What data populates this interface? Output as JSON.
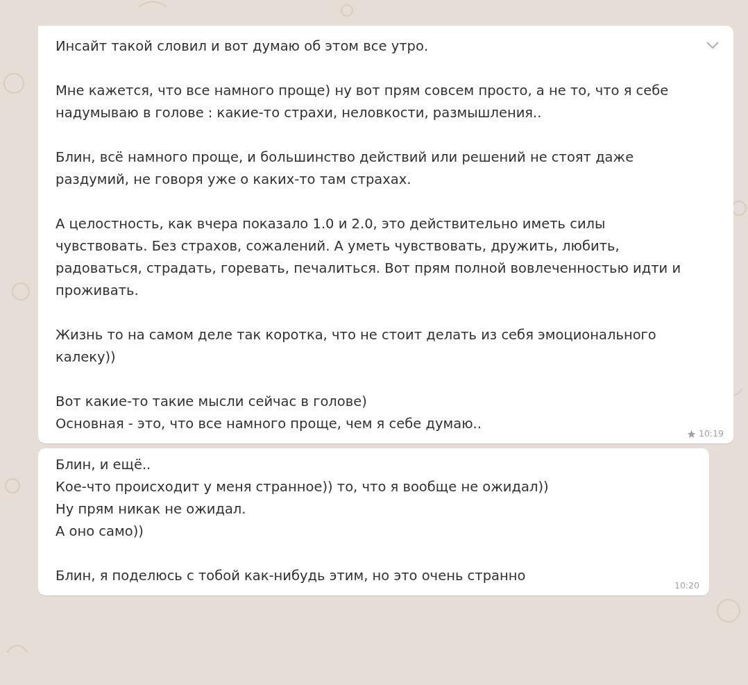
{
  "messages": [
    {
      "paragraphs": [
        [
          "Инсайт такой словил и вот думаю об этом все утро."
        ],
        [
          "Мне кажется, что все намного проще) ну вот прям совсем просто, а не то, что я себе надумываю в голове : какие-то страхи, неловкости, размышления.."
        ],
        [
          "Блин, всё намного проще, и большинство действий или решений не стоят даже раздумий, не говоря уже о каких-то там страхах."
        ],
        [
          "А целостность, как вчера показало 1.0 и 2.0, это действительно иметь силы чувствовать. Без страхов, сожалений. А уметь чувствовать, дружить, любить, радоваться, страдать, горевать, печалиться. Вот прям полной вовлеченностью идти и проживать."
        ],
        [
          "Жизнь то на самом деле так коротка, что не стоит делать из себя эмоционального калеку))"
        ],
        [
          "Вот какие-то такие мысли сейчас в голове)",
          "Основная - это, что все намного проще, чем я себе думаю.."
        ]
      ],
      "time": "10:19",
      "starred": true,
      "menu": true
    },
    {
      "paragraphs": [
        [
          "Блин, и ещё..",
          "Кое-что происходит у меня странное)) то, что я вообще не ожидал))",
          "Ну прям никак не ожидал.",
          "А оно само))"
        ],
        [
          "Блин, я поделюсь с тобой как-нибудь этим, но это очень странно"
        ]
      ],
      "time": "10:20",
      "starred": false,
      "menu": false
    }
  ]
}
